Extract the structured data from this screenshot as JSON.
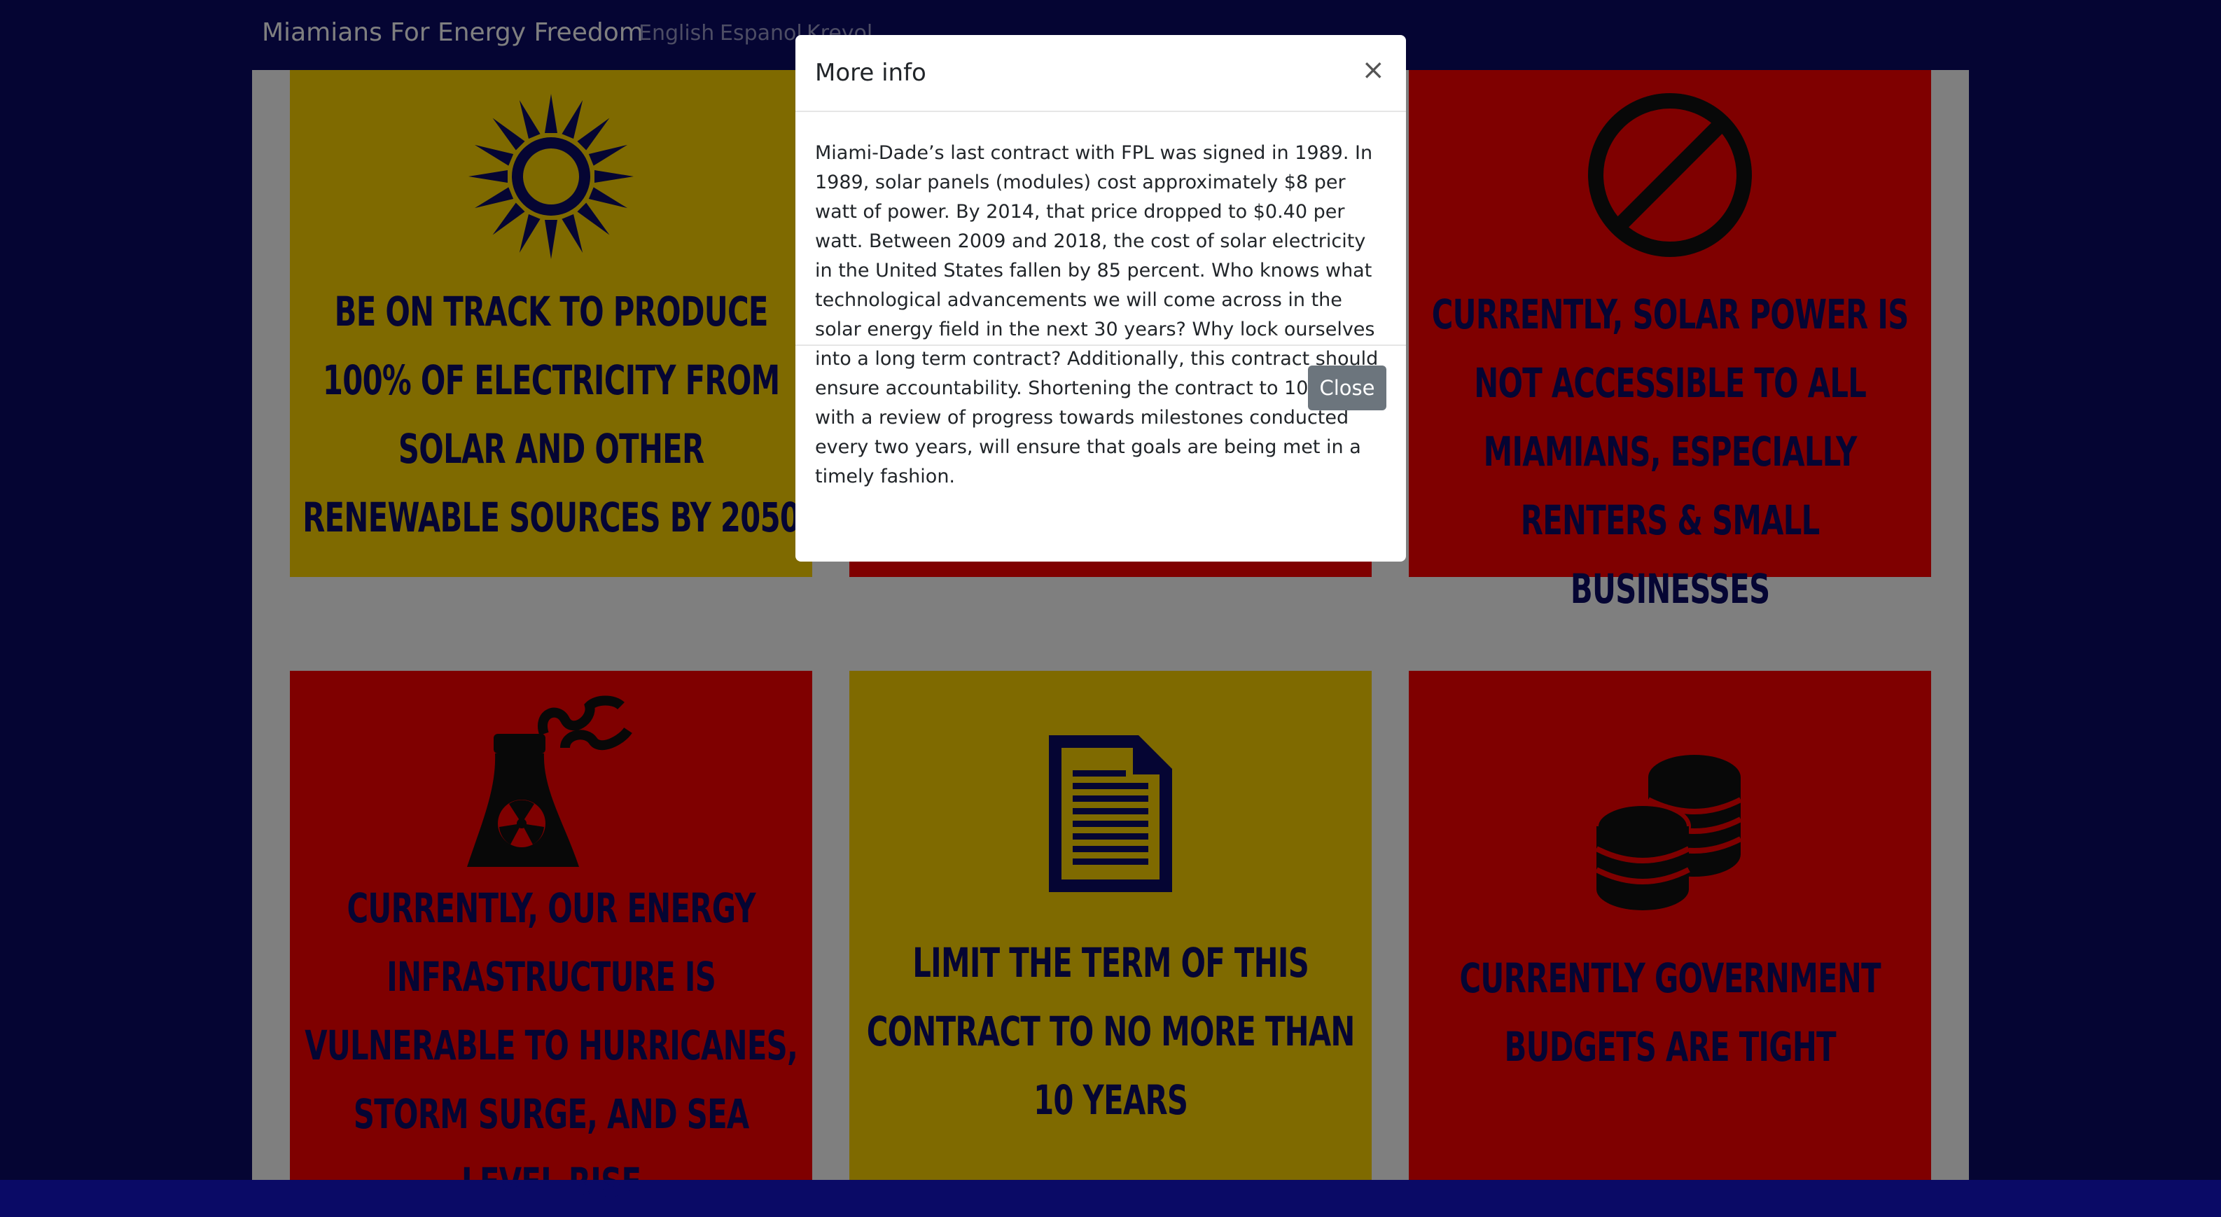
{
  "navbar": {
    "brand": "Miamians For Energy Freedom",
    "languages": [
      "English",
      "Espanol",
      "Kreyol"
    ]
  },
  "cards": [
    {
      "text": "Be on track to produce 100% of electricity from solar and other renewable sources by 2050",
      "color": "#ffd500",
      "icon": "sun-icon"
    },
    {
      "text": "",
      "color": "#ff0000",
      "icon": ""
    },
    {
      "text": "Currently, solar power is not accessible to all Miamians, especially renters & small businesses",
      "color": "#ff0000",
      "icon": "prohibited-icon"
    },
    {
      "text": "Currently, our energy infrastructure is vulnerable to hurricanes, storm surge, and sea level rise",
      "color": "#ff0000",
      "icon": "nuclear-plant-icon"
    },
    {
      "text": "Limit the term of this contract to no more than 10 years",
      "color": "#ffd500",
      "icon": "document-icon"
    },
    {
      "text": "Currently government budgets are tight",
      "color": "#ff0000",
      "icon": "coins-icon"
    }
  ],
  "modal": {
    "title": "More info",
    "close_glyph": "×",
    "body": "Miami-Dade’s last contract with FPL was signed in 1989. In 1989, solar panels (modules) cost approximately $8 per watt of power. By 2014, that price dropped to $0.40 per watt. Between 2009 and 2018, the cost of solar electricity in the United States fallen by 85 percent. Who knows what technological advancements we will come across in the solar energy field in the next 30 years? Why lock ourselves into a long term contract? Additionally, this contract should ensure accountability. Shortening the contract to 10 years, with a review of progress towards milestones conducted every two years, will ensure that goals are being met in a timely fashion.",
    "close_button": "Close"
  },
  "colors": {
    "navy": "#0a0a66",
    "yellow": "#ffd500",
    "red": "#ff0000",
    "button_gray": "#6c757d"
  }
}
